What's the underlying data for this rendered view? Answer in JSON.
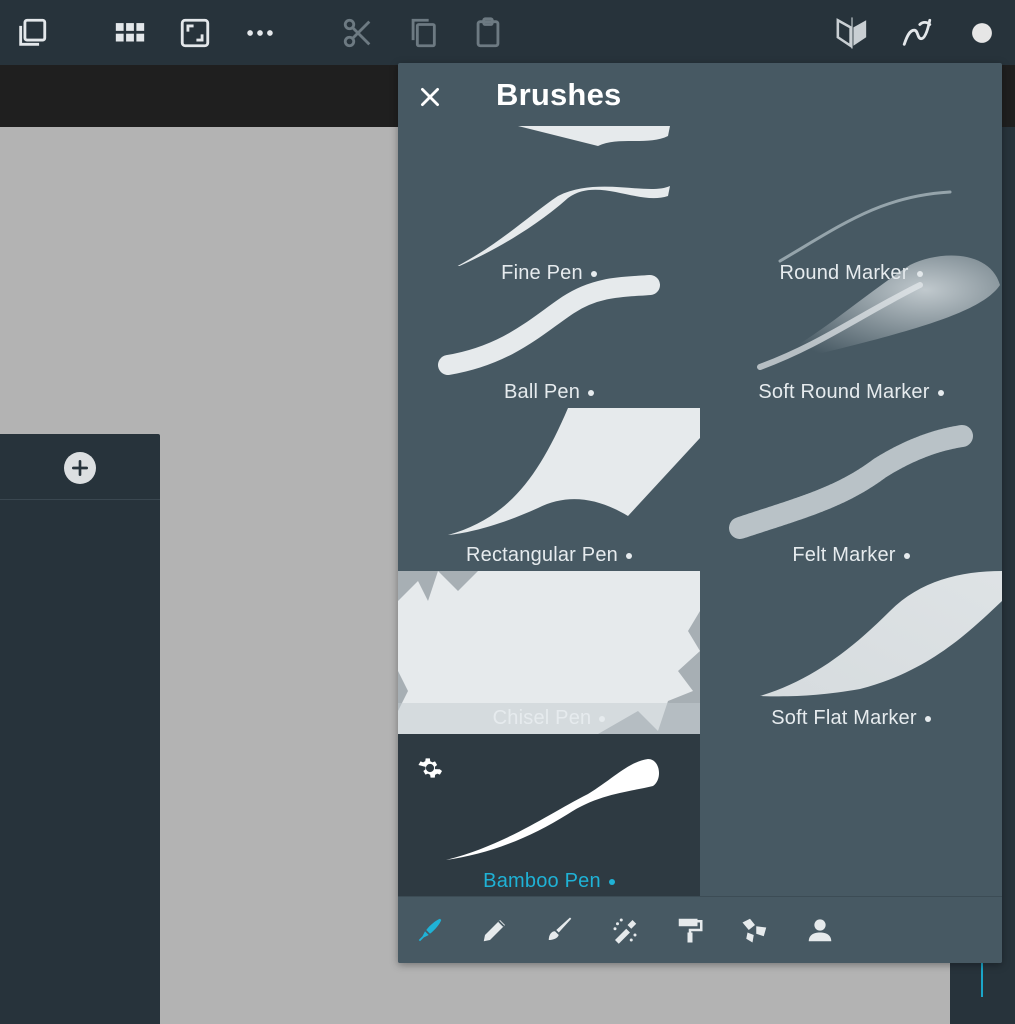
{
  "panel": {
    "title": "Brushes"
  },
  "brushes": [
    {
      "label": "Fine Pen"
    },
    {
      "label": "Round Marker"
    },
    {
      "label": "Ball Pen"
    },
    {
      "label": "Soft Round Marker"
    },
    {
      "label": "Rectangular Pen"
    },
    {
      "label": "Felt Marker"
    },
    {
      "label": "Chisel Pen"
    },
    {
      "label": "Soft Flat Marker"
    },
    {
      "label": "Bamboo Pen"
    }
  ],
  "selected_brush": "Bamboo Pen",
  "colors": {
    "accent": "#1fb2d6",
    "toolbar": "#27333b",
    "panel": "#475963"
  },
  "toolbar_icons": [
    "layers-icon",
    "grid-icon",
    "fit-screen-icon",
    "more-icon",
    "cut-icon",
    "copy-icon",
    "paste-icon",
    "symmetry-icon",
    "stroke-icon",
    "color-dot-icon"
  ],
  "tab_icons": [
    "pen-tab-icon",
    "pencil-tab-icon",
    "brush-tab-icon",
    "airbrush-tab-icon",
    "roller-tab-icon",
    "shapes-tab-icon",
    "person-tab-icon"
  ]
}
